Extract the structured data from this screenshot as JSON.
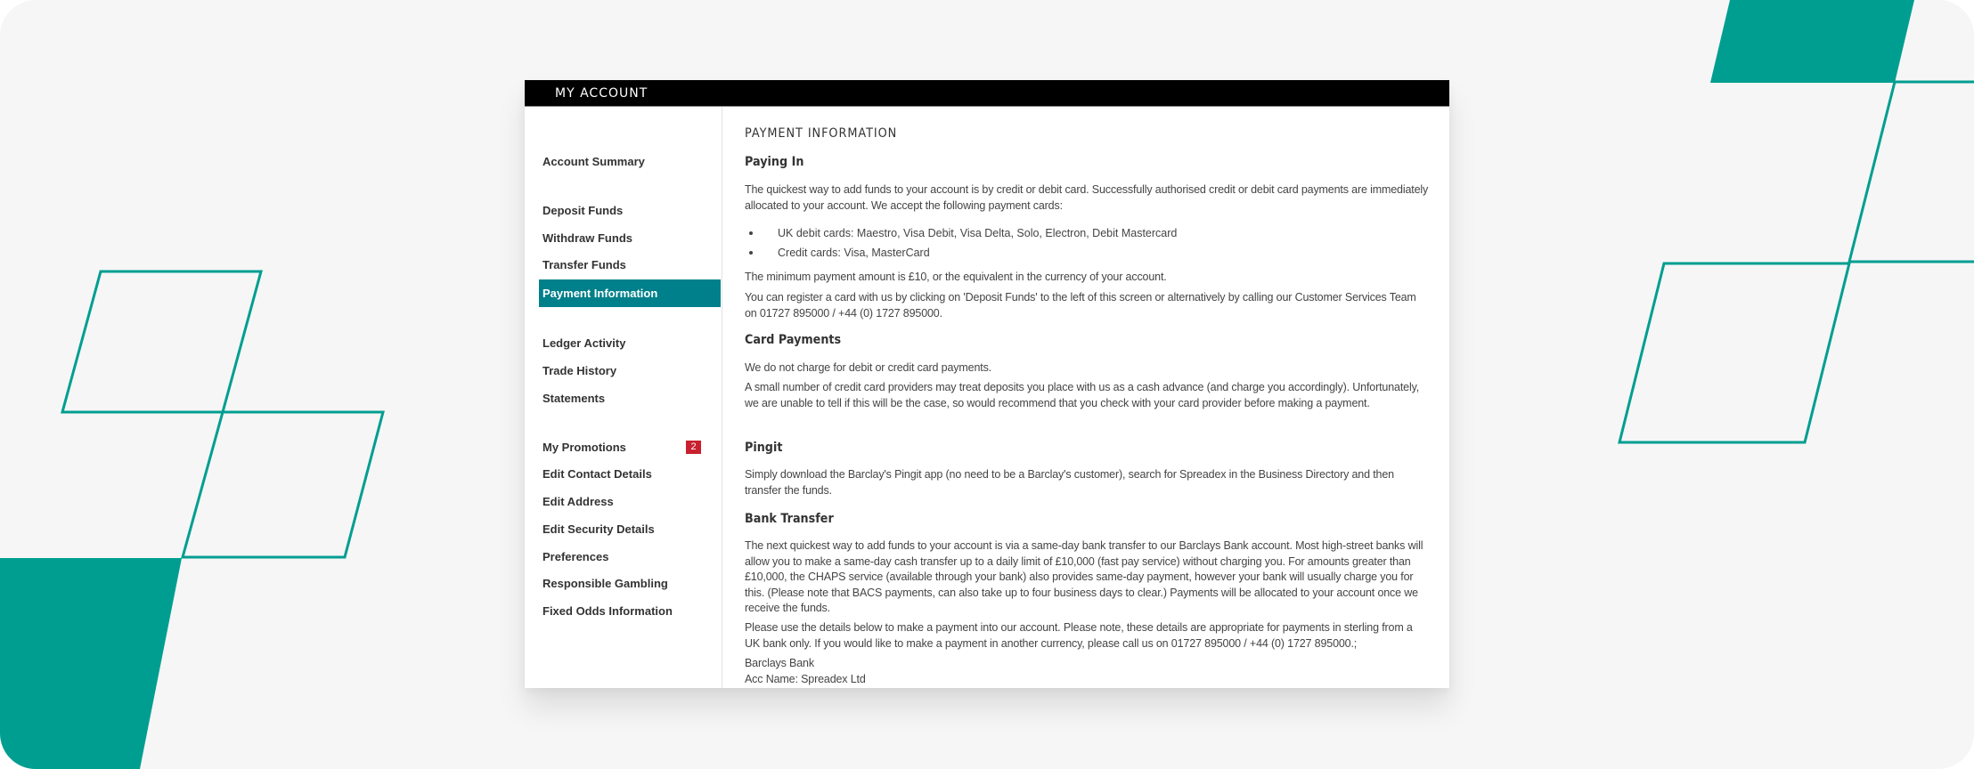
{
  "colors": {
    "accent": "#00808a",
    "decoration": "#009e91",
    "badge": "#c8202e",
    "header_bg": "#000000"
  },
  "header": {
    "title": "MY ACCOUNT"
  },
  "sidebar": {
    "items": [
      {
        "label": "Account Summary"
      },
      {
        "label": "Deposit Funds"
      },
      {
        "label": "Withdraw Funds"
      },
      {
        "label": "Transfer Funds"
      },
      {
        "label": "Payment Information",
        "active": true
      },
      {
        "label": "Ledger Activity"
      },
      {
        "label": "Trade History"
      },
      {
        "label": "Statements"
      },
      {
        "label": "My Promotions",
        "badge": "2"
      },
      {
        "label": "Edit Contact Details"
      },
      {
        "label": "Edit Address"
      },
      {
        "label": "Edit Security Details"
      },
      {
        "label": "Preferences"
      },
      {
        "label": "Responsible Gambling"
      },
      {
        "label": "Fixed Odds Information"
      }
    ]
  },
  "content": {
    "page_title": "PAYMENT INFORMATION",
    "paying_in": {
      "heading": "Paying In",
      "intro": "The quickest way to add funds to your account is by credit or debit card. Successfully authorised credit or debit card payments are immediately allocated to your account. We accept the following payment cards:",
      "bullets": [
        "UK debit cards: Maestro, Visa Debit, Visa Delta, Solo, Electron, Debit Mastercard",
        "Credit cards: Visa, MasterCard"
      ],
      "minimum": "The minimum payment amount is £10, or the equivalent in the currency of your account.",
      "register": "You can register a card with us by clicking on 'Deposit Funds' to the left of this screen or alternatively by calling our Customer Services Team on 01727 895000 / +44 (0) 1727 895000."
    },
    "card_payments": {
      "heading": "Card Payments",
      "p1": "We do not charge for debit or credit card payments.",
      "p2": "A small number of credit card providers may treat deposits you place with us as a cash advance (and charge you accordingly). Unfortunately, we are unable to tell if this will be the case, so would recommend that you check with your card provider before making a payment."
    },
    "pingit": {
      "heading": "Pingit",
      "p1": "Simply download the Barclay's Pingit app (no need to be a Barclay's customer), search for Spreadex in the Business Directory and then transfer the funds."
    },
    "bank_transfer": {
      "heading": "Bank Transfer",
      "p1": "The next quickest way to add funds to your account is via a same-day bank transfer to our Barclays Bank account. Most high-street banks will allow you to make a same-day cash transfer up to a daily limit of £10,000 (fast pay service) without charging you. For amounts greater than £10,000, the CHAPS service (available through your bank) also provides same-day payment, however your bank will usually charge you for this. (Please note that BACS payments, can also take up to four business days to clear.) Payments will be allocated to your account once we receive the funds.",
      "p2": "Please use the details below to make a payment into our account. Please note, these details are appropriate for payments in sterling from a UK bank only. If you would like to make a payment in another currency, please call us on 01727 895000 / +44 (0) 1727 895000.;",
      "bank_name": "Barclays Bank",
      "acc_name": "Acc Name: Spreadex Ltd"
    }
  }
}
